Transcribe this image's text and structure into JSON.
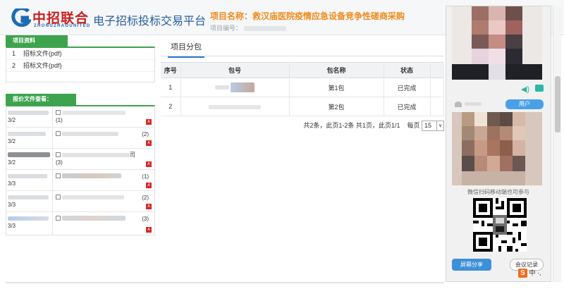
{
  "header": {
    "logo_cn": "中招联合",
    "logo_en": "ZHONGZHAOUNITED",
    "platform_title": "电子招标投标交易平台",
    "project_name": "项目名称：救汉庙医院疫情应急设备竞争性磋商采购",
    "project_no_label": "项目编号："
  },
  "left": {
    "project_docs_title": "项目资料",
    "project_docs": [
      {
        "num": "1",
        "label": "招标文件(pdf)"
      },
      {
        "num": "2",
        "label": "招标文件(pdf)"
      }
    ],
    "quote_title": "报价文件查看：",
    "quote_rows": [
      {
        "ratio": "3/2",
        "count": "(1)",
        "extra": ""
      },
      {
        "ratio": "3/2",
        "count": "(2)",
        "extra": ""
      },
      {
        "ratio": "3/2",
        "count": "(3)",
        "extra": "司"
      },
      {
        "ratio": "3/3",
        "count": "(1)",
        "extra": ""
      },
      {
        "ratio": "3/3",
        "count": "(2)",
        "extra": ""
      },
      {
        "ratio": "3/3",
        "count": "(3)",
        "extra": ""
      }
    ]
  },
  "main": {
    "tab_label": "项目分包",
    "table": {
      "headers": [
        "序号",
        "包号",
        "包名称",
        "状态"
      ],
      "rows": [
        {
          "index": "1",
          "name": "第1包",
          "status": "已完成"
        },
        {
          "index": "2",
          "name": "第2包",
          "status": "已完成"
        }
      ]
    },
    "pager": {
      "summary": "共2条，此页1-2条 共1页，此页1/1",
      "per_page_label": "每页",
      "per_page_value": "15"
    }
  },
  "right": {
    "user_button": "用户",
    "scan_text": "微信扫码移动端也可参与",
    "share_button": "屏幕分享",
    "record_button": "会议记录"
  },
  "ime": {
    "badge": "S",
    "text": "中 ·,"
  },
  "colors": {
    "green": "#3da44d",
    "orange": "#f08a1c",
    "brand_red": "#c9201f",
    "brand_blue": "#1b6bb5",
    "accent_blue": "#3d8fd8"
  }
}
